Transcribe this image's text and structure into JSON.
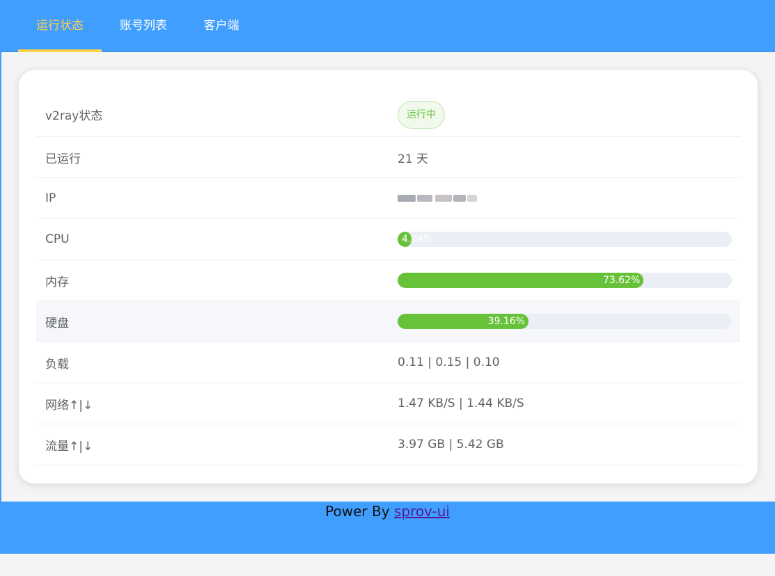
{
  "nav": {
    "items": [
      {
        "label": "运行状态",
        "active": true
      },
      {
        "label": "账号列表",
        "active": false
      },
      {
        "label": "客户端",
        "active": false
      }
    ],
    "active_color": "#ffd04b",
    "bg_color": "#409eff"
  },
  "status": {
    "rows": {
      "v2ray": {
        "label": "v2ray状态",
        "value": "运行中"
      },
      "uptime": {
        "label": "已运行",
        "value": "21 天"
      },
      "ip": {
        "label": "IP",
        "value": ""
      },
      "cpu": {
        "label": "CPU",
        "percent": 4.04,
        "text": "4.04%"
      },
      "memory": {
        "label": "内存",
        "percent": 73.62,
        "text": "73.62%"
      },
      "disk": {
        "label": "硬盘",
        "percent": 39.16,
        "text": "39.16%"
      },
      "load": {
        "label": "负载",
        "value": "0.11 | 0.15 | 0.10"
      },
      "network": {
        "label": "网络↑|↓",
        "value": "1.47 KB/S | 1.44 KB/S"
      },
      "traffic": {
        "label": "流量↑|↓",
        "value": "3.97 GB | 5.42 GB"
      }
    },
    "bar_color": "#67c23a",
    "track_color": "#ebeef5"
  },
  "footer": {
    "prefix": "Power By ",
    "link_label": "sprov-ui"
  }
}
